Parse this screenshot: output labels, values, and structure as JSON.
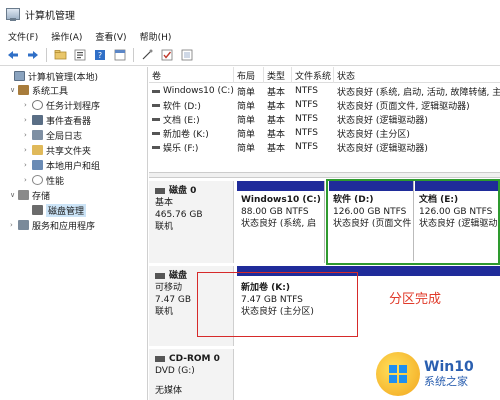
{
  "window": {
    "title": "计算机管理"
  },
  "menu": [
    "文件(F)",
    "操作(A)",
    "查看(V)",
    "帮助(H)"
  ],
  "toolbar_icons": [
    "back-arrow-icon",
    "forward-arrow-icon",
    "folder-up-icon",
    "properties-icon",
    "help-icon",
    "show-hide-icon",
    "connect-icon",
    "check-icon",
    "export-icon"
  ],
  "tree": [
    {
      "label": "计算机管理(本地)",
      "icon": "computer-icon",
      "arrow": ""
    },
    {
      "label": "系统工具",
      "icon": "tools-icon",
      "arrow": "v"
    },
    {
      "label": "任务计划程序",
      "icon": "clock-icon",
      "arrow": ">"
    },
    {
      "label": "事件查看器",
      "icon": "event-viewer-icon",
      "arrow": ">"
    },
    {
      "label": "全局日志",
      "icon": "log-icon",
      "arrow": ">"
    },
    {
      "label": "共享文件夹",
      "icon": "shared-folder-icon",
      "arrow": ">"
    },
    {
      "label": "本地用户和组",
      "icon": "users-icon",
      "arrow": ">"
    },
    {
      "label": "性能",
      "icon": "performance-icon",
      "arrow": ">"
    },
    {
      "label": "存储",
      "icon": "storage-icon",
      "arrow": "v"
    },
    {
      "label": "磁盘管理",
      "icon": "disk-management-icon",
      "arrow": ""
    },
    {
      "label": "服务和应用程序",
      "icon": "services-icon",
      "arrow": ">"
    }
  ],
  "volume_table": {
    "headers": [
      "卷",
      "布局",
      "类型",
      "文件系统",
      "状态"
    ],
    "rows": [
      [
        "Windows10 (C:)",
        "简单",
        "基本",
        "NTFS",
        "状态良好 (系统, 启动, 活动, 故障转储, 主"
      ],
      [
        "软件 (D:)",
        "简单",
        "基本",
        "NTFS",
        "状态良好 (页面文件, 逻辑驱动器)"
      ],
      [
        "文档 (E:)",
        "简单",
        "基本",
        "NTFS",
        "状态良好 (逻辑驱动器)"
      ],
      [
        "新加卷 (K:)",
        "简单",
        "基本",
        "NTFS",
        "状态良好 (主分区)"
      ],
      [
        "娱乐 (F:)",
        "简单",
        "基本",
        "NTFS",
        "状态良好 (逻辑驱动器)"
      ]
    ]
  },
  "disks": [
    {
      "name": "磁盘 0",
      "lines": [
        "基本",
        "465.76 GB",
        "联机"
      ],
      "partitions": [
        {
          "name": "Windows10 (C:)",
          "size": "88.00 GB NTFS",
          "status": "状态良好 (系统, 启"
        },
        {
          "name": "软件 (D:)",
          "size": "126.00 GB NTFS",
          "status": "状态良好 (页面文件"
        },
        {
          "name": "文档 (E:)",
          "size": "126.00 GB NTFS",
          "status": "状态良好 (逻辑驱动"
        }
      ]
    },
    {
      "name": "磁盘",
      "lines": [
        "可移动",
        "7.47 GB",
        "联机"
      ],
      "partitions": [
        {
          "name": "新加卷 (K:)",
          "size": "7.47 GB NTFS",
          "status": "状态良好 (主分区)"
        }
      ]
    },
    {
      "name": "CD-ROM 0",
      "lines": [
        "DVD (G:)",
        "",
        "无媒体"
      ],
      "partitions": []
    }
  ],
  "annotation": "分区完成",
  "watermark": {
    "title": "Win10",
    "subtitle": "系统之家"
  },
  "colors": {
    "partition_bar": "#1f2b9a",
    "highlight_green": "#2e9a2e",
    "highlight_red": "#d62a2a",
    "annotation": "#e03a2a"
  }
}
